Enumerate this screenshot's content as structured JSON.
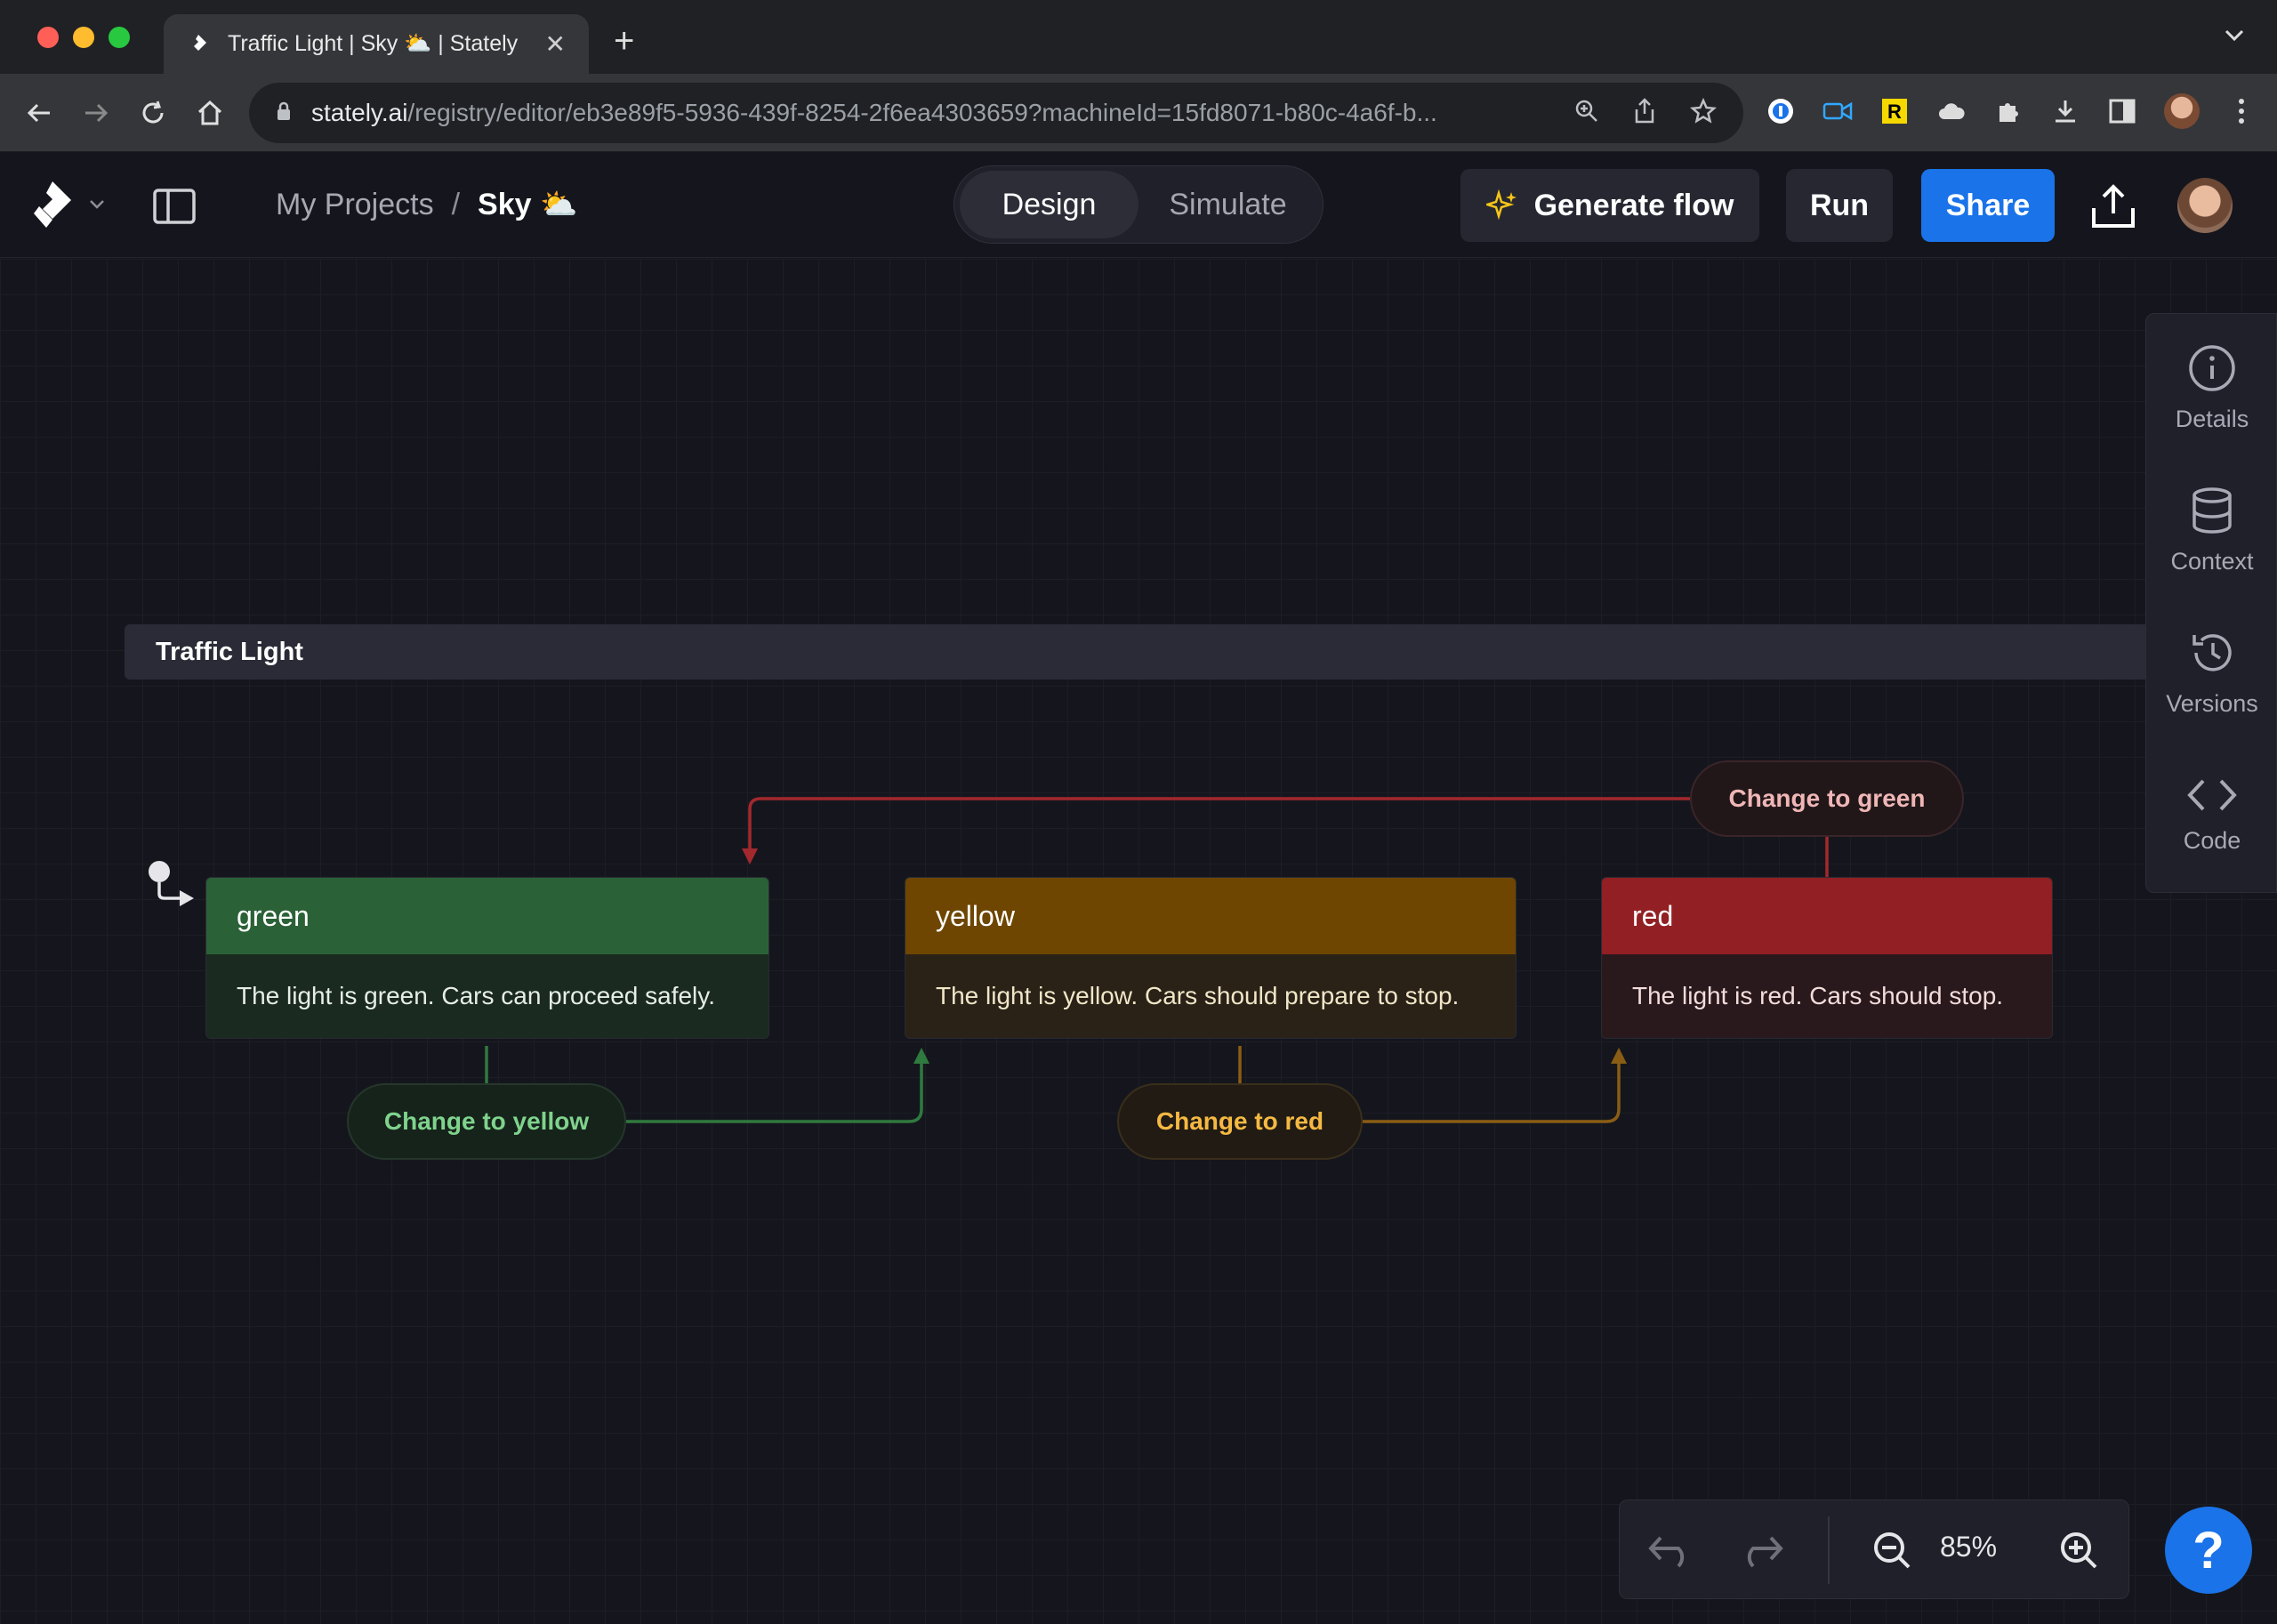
{
  "browser": {
    "tab_title": "Traffic Light | Sky ⛅ | Stately",
    "tab_close": "✕",
    "new_tab": "+",
    "url_host": "stately.ai",
    "url_path": "/registry/editor/eb3e89f5-5936-439f-8254-2f6ea4303659?machineId=15fd8071-b80c-4a6f-b..."
  },
  "header": {
    "breadcrumb": {
      "projects": "My Projects",
      "separator": "/",
      "current": "Sky ⛅"
    },
    "modes": {
      "design": "Design",
      "simulate": "Simulate",
      "active": "design"
    },
    "generate_flow": "Generate flow",
    "run": "Run",
    "share": "Share"
  },
  "canvas": {
    "machine_name": "Traffic Light",
    "states": [
      {
        "name": "green",
        "description": "The light is green. Cars can proceed safely."
      },
      {
        "name": "yellow",
        "description": "The light is yellow. Cars should prepare to stop."
      },
      {
        "name": "red",
        "description": "The light is red. Cars should stop."
      }
    ],
    "events": {
      "to_yellow": "Change to yellow",
      "to_red": "Change to red",
      "to_green": "Change to green"
    }
  },
  "side_panel": {
    "items": [
      {
        "label": "Details",
        "icon": "info-icon"
      },
      {
        "label": "Context",
        "icon": "database-icon"
      },
      {
        "label": "Versions",
        "icon": "history-icon"
      },
      {
        "label": "Code",
        "icon": "code-icon"
      }
    ]
  },
  "zoom": {
    "level": "85%"
  },
  "help": {
    "label": "?"
  },
  "colors": {
    "accent": "#1a73e8",
    "green_state": "#2b6137",
    "yellow_state": "#6e4602",
    "red_state": "#921f23"
  }
}
